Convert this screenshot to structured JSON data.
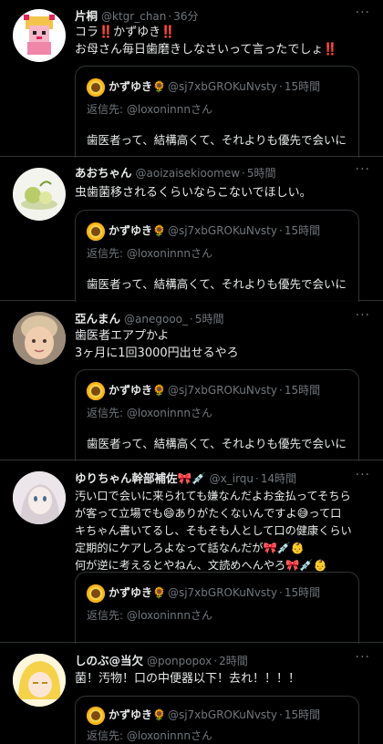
{
  "tweets": [
    {
      "name": "片桐",
      "handle": "@ktgr_chan",
      "time": "36分",
      "lines": [
        "コラ‼️かずゆき‼️",
        "お母さん毎日歯磨きしなさいって言ったでしょ‼️"
      ],
      "avatar": "pixel-art-character-avatar"
    },
    {
      "name": "あおちゃん",
      "handle": "@aoizaisekioomew",
      "time": "5時間",
      "lines": [
        "虫歯菌移されるくらいならこないでほしい。"
      ],
      "avatar": "green-objects-avatar"
    },
    {
      "name": "亞んまん",
      "handle": "@anegooo_",
      "time": "5時間",
      "lines": [
        "歯医者エアプかよ",
        "3ヶ月に1回3000円出せるやろ"
      ],
      "avatar": "child-photo-avatar"
    },
    {
      "name": "ゆりちゃん幹部補佐🎀💉",
      "handle": "@x_irqu",
      "time": "14時間",
      "lines": [
        "汚い口で会いに来られても嫌なんだよお金払ってそちら",
        "が客って立場でも😄ありがたくないんですよ😅って口",
        "キちゃん書いてるし、そもそも人として口の健康くらい",
        "定期的にケアしろよなって話なんだが🎀💉👶",
        "何が逆に考えるとやねん、文読めへんやろ🎀💉👶"
      ],
      "avatar": "anime-girl-avatar"
    },
    {
      "name": "しのぶ@当欠",
      "handle": "@ponpopox",
      "time": "2時間",
      "lines": [
        "菌！汚物！口の中便器以下！去れ！！！！"
      ],
      "avatar": "blonde-anime-girl-avatar"
    }
  ],
  "quoted": {
    "name": "かずゆき🌻",
    "handle": "@sj7xbGROKuNvsty",
    "time": "15時間",
    "reply_prefix": "返信先: ",
    "reply_to": "@loxoninnnさん",
    "text": "歯医者って、結構高くて、それよりも優先で会いに"
  },
  "ui": {
    "more_glyph": "···",
    "separator": "·"
  }
}
